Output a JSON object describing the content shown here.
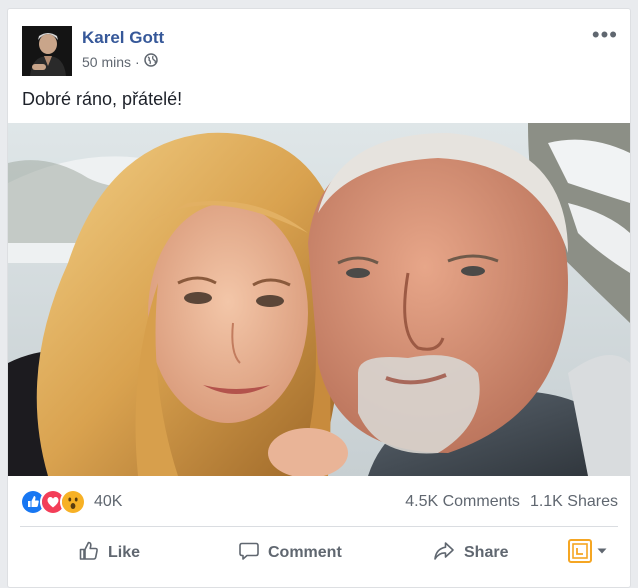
{
  "post": {
    "author": "Karel Gott",
    "time": "50 mins",
    "separator": "·",
    "status": "Dobré ráno, přátelé!",
    "more_icon": "more-horizontal-icon",
    "privacy_icon": "globe-icon"
  },
  "reactions": {
    "icons": [
      "like-icon",
      "love-icon",
      "wow-icon"
    ],
    "count": "40K",
    "comments": "4.5K Comments",
    "shares": "1.1K Shares"
  },
  "actions": {
    "like": "Like",
    "comment": "Comment",
    "share": "Share"
  },
  "colors": {
    "link": "#365899",
    "muted": "#606770",
    "like": "#1877f2",
    "love": "#f33e58",
    "wow": "#f7b125",
    "page_icon": "#f5a623"
  }
}
